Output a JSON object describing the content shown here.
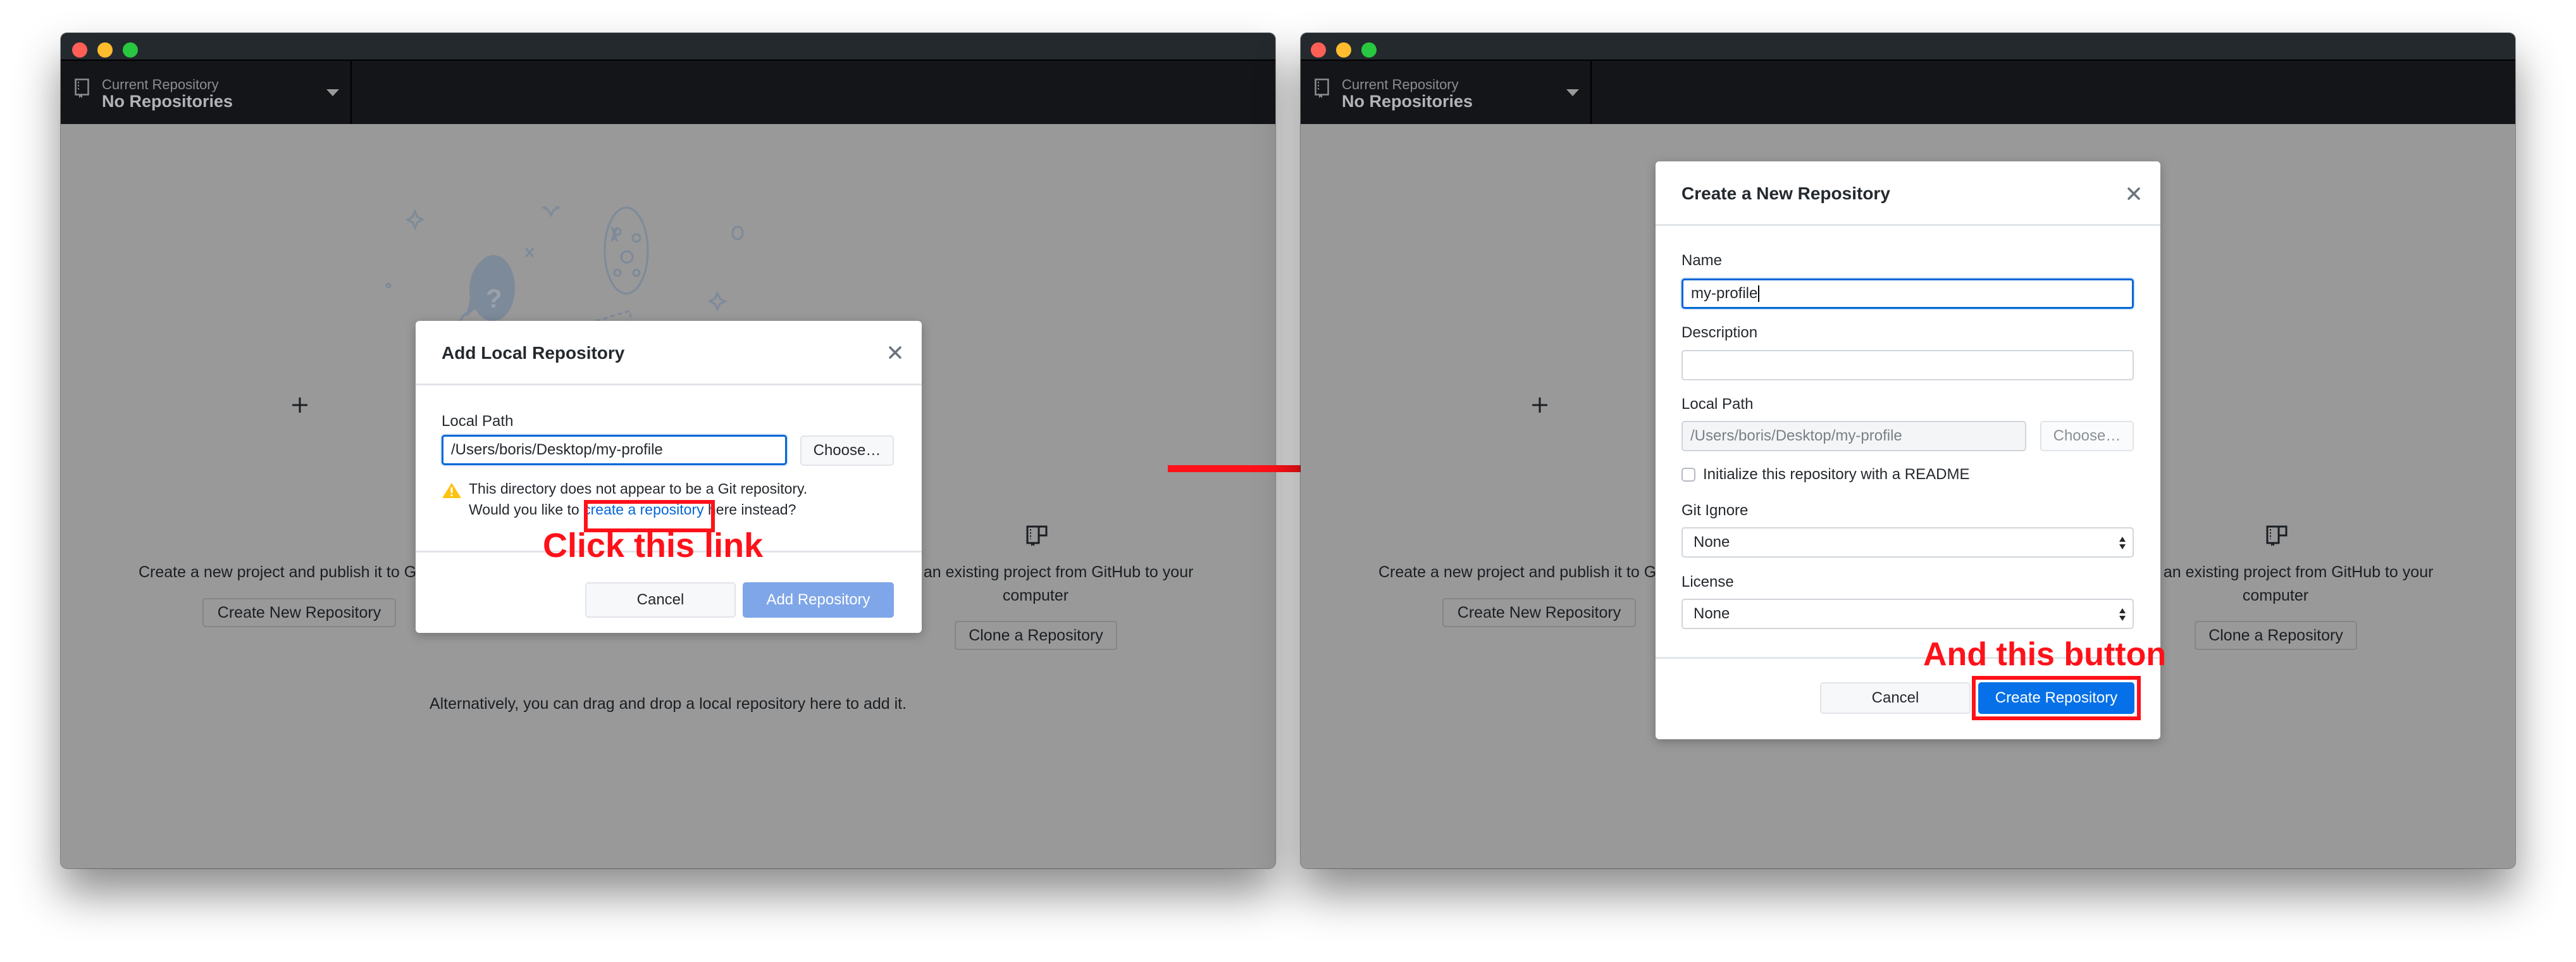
{
  "windows": [
    {
      "id": "left",
      "toolbar": {
        "repo_label": "Current Repository",
        "repo_value": "No Repositories"
      },
      "background": {
        "create_text": "Create a new project and publish it to GitHub",
        "create_button": "Create New Repository",
        "clone_text_line1": "Clone an existing project from GitHub to your",
        "clone_text_line2": "computer",
        "clone_button": "Clone a Repository",
        "drag_drop_text": "Alternatively, you can drag and drop a local repository here to add it."
      },
      "dialog": {
        "title": "Add Local Repository",
        "local_path_label": "Local Path",
        "local_path_value": "/Users/boris/Desktop/my-profile",
        "choose_button": "Choose…",
        "warning_line1": "This directory does not appear to be a Git repository.",
        "warning_line2_prefix": "Would you like to ",
        "warning_link": "create a repository",
        "warning_line2_suffix": " here instead?",
        "cancel_button": "Cancel",
        "submit_button": "Add Repository"
      },
      "annotation": "Click this link"
    },
    {
      "id": "right",
      "toolbar": {
        "repo_label": "Current Repository",
        "repo_value": "No Repositories"
      },
      "background": {
        "create_text": "Create a new project and publish it to GitHub",
        "create_button": "Create New Repository",
        "clone_text_line1": "Clone an existing project from GitHub to your",
        "clone_text_line2": "computer",
        "clone_button": "Clone a Repository"
      },
      "dialog": {
        "title": "Create a New Repository",
        "name_label": "Name",
        "name_value": "my-profile",
        "description_label": "Description",
        "description_value": "",
        "local_path_label": "Local Path",
        "local_path_value": "/Users/boris/Desktop/my-profile",
        "choose_button": "Choose…",
        "readme_checkbox_label": "Initialize this repository with a README",
        "readme_checked": false,
        "gitignore_label": "Git Ignore",
        "gitignore_value": "None",
        "license_label": "License",
        "license_value": "None",
        "cancel_button": "Cancel",
        "submit_button": "Create Repository"
      },
      "annotation": "And this button"
    }
  ],
  "colors": {
    "annotation_red": "#ff1119",
    "primary_blue": "#0670e8",
    "disabled_blue": "#7fa6e8",
    "link_blue": "#0366d6",
    "toolbar_dark": "#131519",
    "overlay_gray": "#999999"
  },
  "icons": {
    "repo": "repo-book-icon",
    "clone": "repo-clone-icon",
    "add": "plus-icon",
    "warning": "warning-triangle-icon",
    "close": "close-x-icon",
    "select": "select-updown-arrows-icon",
    "flow": "arrow-right-icon"
  }
}
